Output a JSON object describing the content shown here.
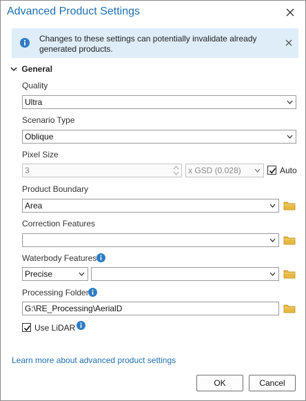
{
  "window": {
    "title": "Advanced Product Settings"
  },
  "banner": {
    "message": "Changes to these settings can potentially invalidate already generated products."
  },
  "section": {
    "label": "General"
  },
  "quality": {
    "label": "Quality",
    "value": "Ultra"
  },
  "scenario_type": {
    "label": "Scenario Type",
    "value": "Oblique"
  },
  "pixel_size": {
    "label": "Pixel Size",
    "value": "3",
    "unit_value": "x GSD (0.028)",
    "auto_label": "Auto",
    "auto_checked": true
  },
  "product_boundary": {
    "label": "Product Boundary",
    "value": "Area"
  },
  "correction_features": {
    "label": "Correction Features",
    "value": ""
  },
  "waterbody_features": {
    "label": "Waterbody Features",
    "mode_value": "Precise",
    "layer_value": ""
  },
  "processing_folder": {
    "label": "Processing Folder",
    "value": "G:\\RE_Processing\\AerialD"
  },
  "use_lidar": {
    "label": "Use LiDAR",
    "checked": true
  },
  "footer": {
    "learn_more": "Learn more about advanced product settings",
    "ok_label": "OK",
    "cancel_label": "Cancel"
  },
  "colors": {
    "accent": "#1f6fb2",
    "banner_bg": "#deedf8",
    "folder": "#e8b93f"
  },
  "icons": {
    "close": "close-icon",
    "info": "info-icon",
    "chevron": "chevron-down-icon",
    "caret": "dropdown-caret-icon",
    "folder": "folder-icon",
    "help": "help-icon",
    "check": "checkmark-icon"
  }
}
